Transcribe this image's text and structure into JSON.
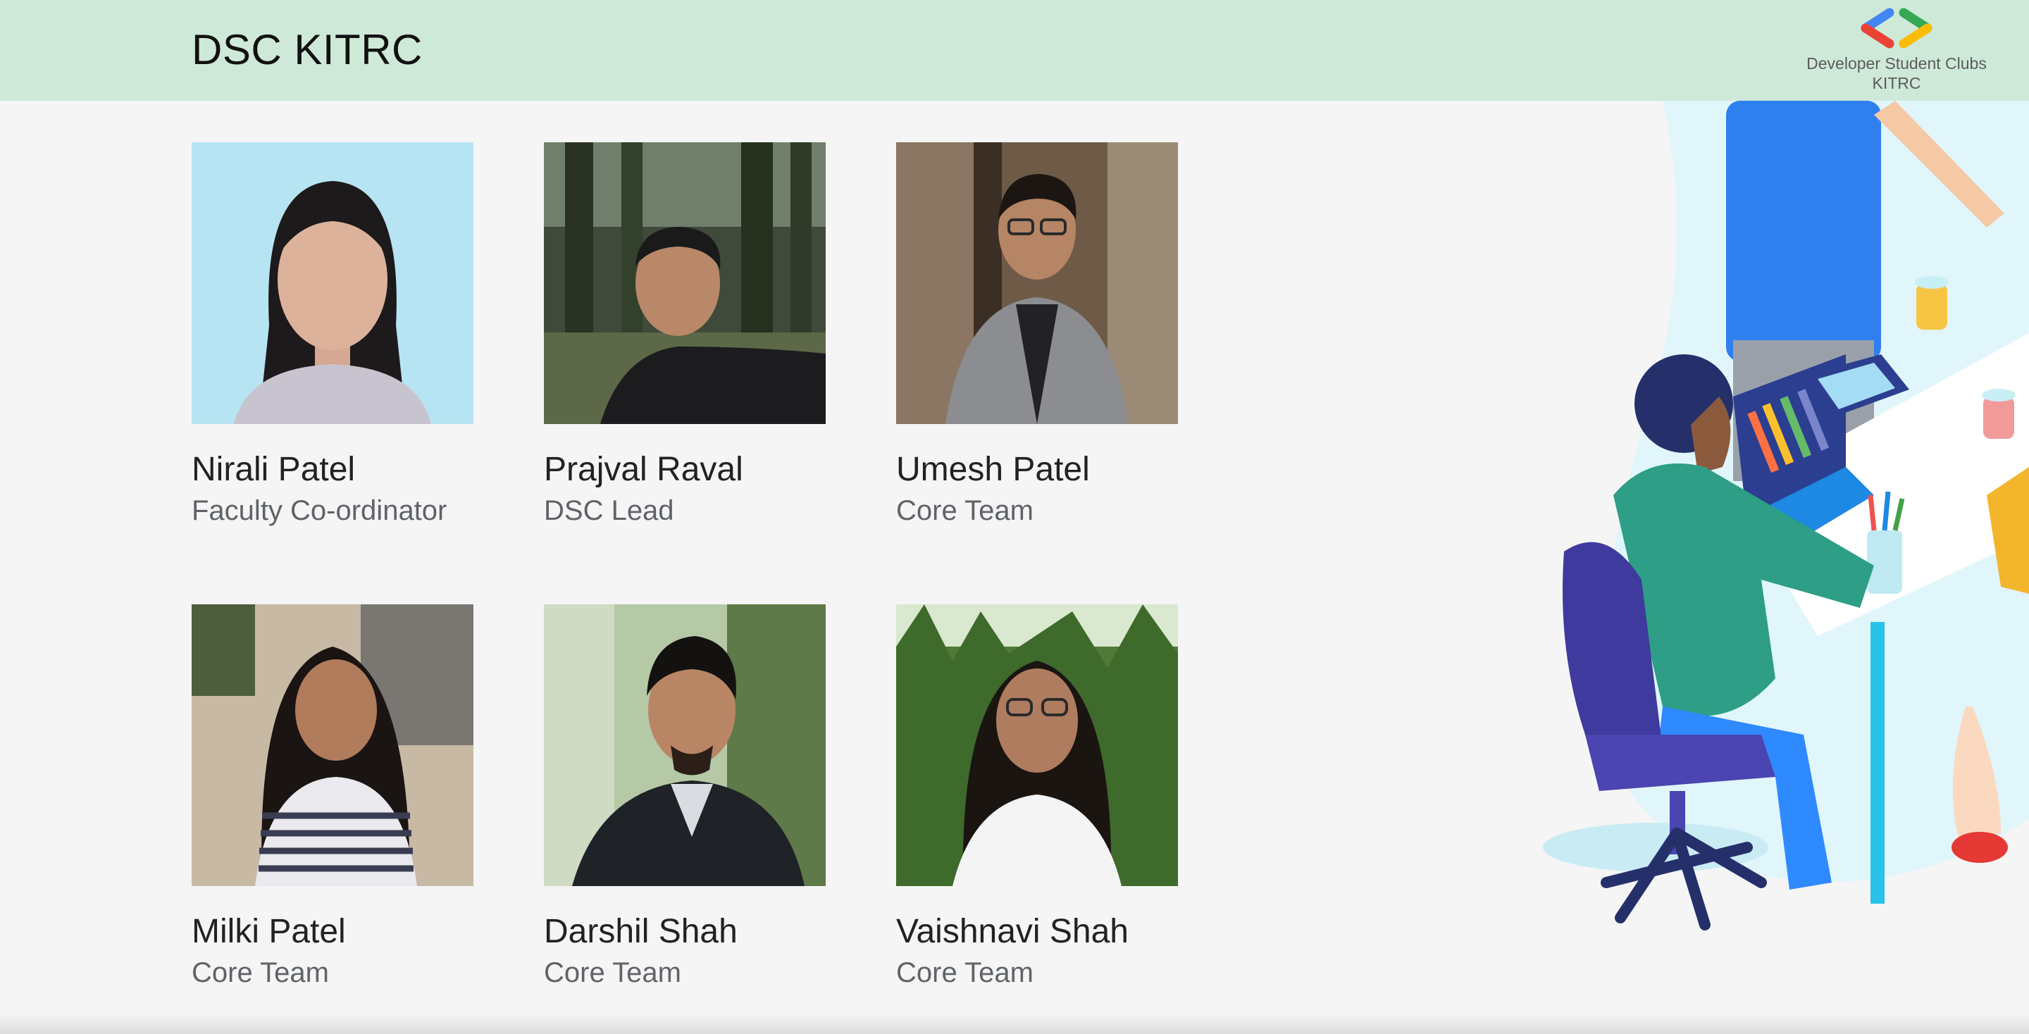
{
  "header": {
    "title": "DSC KITRC",
    "brand_line1": "Developer Student Clubs",
    "brand_line2": "KITRC",
    "logo_icon": "dsc-brackets-logo-icon",
    "logo_colors": [
      "#4285F4",
      "#EA4335",
      "#34A853",
      "#FBBC04"
    ]
  },
  "team": [
    {
      "name": "Nirali Patel",
      "role": "Faculty Co-ordinator"
    },
    {
      "name": "Prajval Raval",
      "role": "DSC Lead"
    },
    {
      "name": "Umesh Patel",
      "role": "Core Team"
    },
    {
      "name": "Milki Patel",
      "role": "Core Team"
    },
    {
      "name": "Darshil Shah",
      "role": "Core Team"
    },
    {
      "name": "Vaishnavi Shah",
      "role": "Core Team"
    }
  ],
  "colors": {
    "header_bg": "#cfe9d9",
    "page_bg": "#f5f5f5",
    "name_text": "#222222",
    "role_text": "#5f6368"
  }
}
